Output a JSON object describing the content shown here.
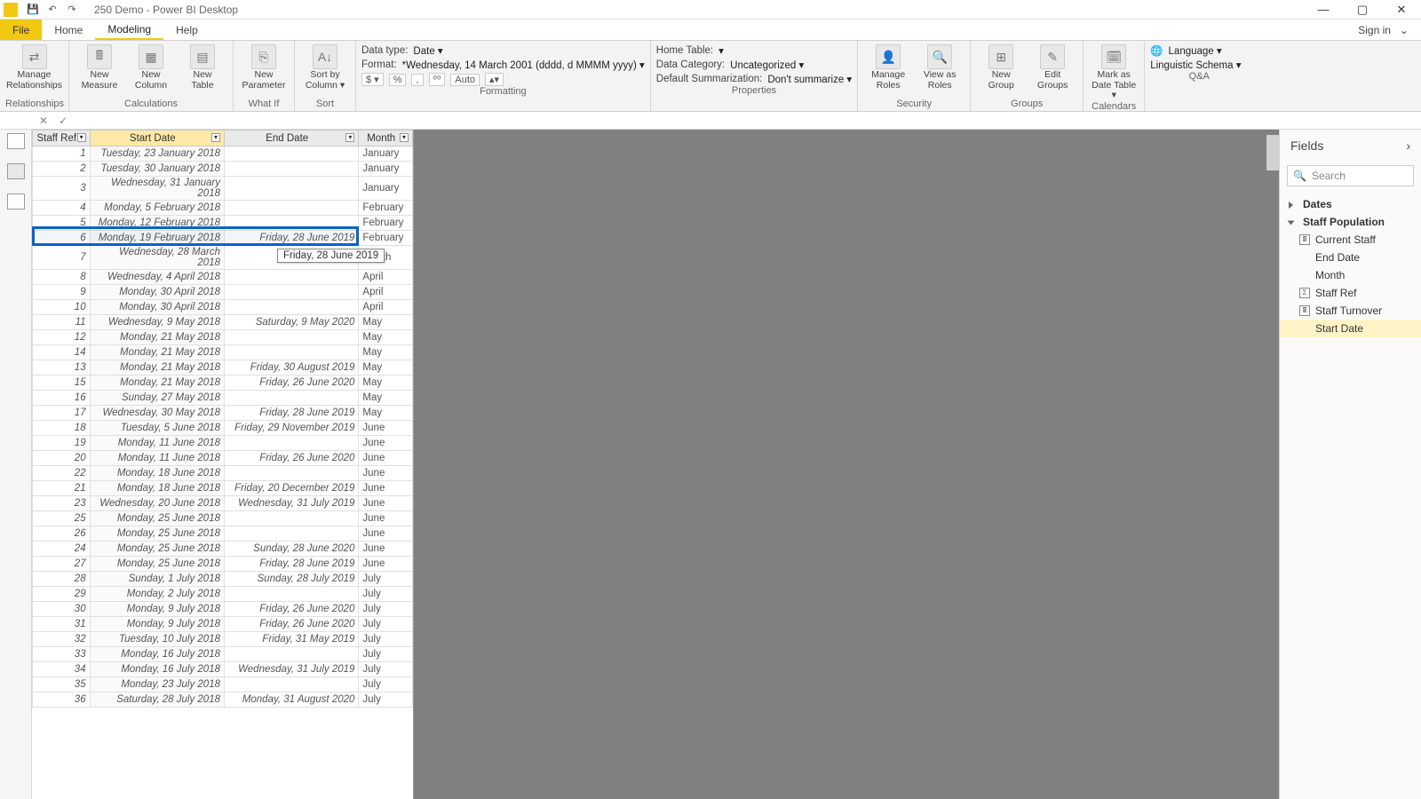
{
  "app": {
    "title": "250 Demo - Power BI Desktop"
  },
  "qat": {
    "save": "💾",
    "undo": "↶",
    "redo": "↷"
  },
  "winctl": {
    "min": "—",
    "max": "▢",
    "close": "✕"
  },
  "menu": {
    "file": "File",
    "home": "Home",
    "modeling": "Modeling",
    "help": "Help",
    "signin": "Sign in"
  },
  "ribbon": {
    "relationships": {
      "manage": "Manage\nRelationships",
      "group": "Relationships"
    },
    "calc": {
      "measure": "New\nMeasure",
      "column": "New\nColumn",
      "table": "New\nTable",
      "group": "Calculations"
    },
    "whatif": {
      "param": "New\nParameter",
      "group": "What If"
    },
    "sort": {
      "sortby": "Sort by\nColumn ▾",
      "group": "Sort"
    },
    "fmt": {
      "datatype_l": "Data type:",
      "datatype_v": "Date ▾",
      "format_l": "Format:",
      "format_v": "*Wednesday, 14 March 2001 (dddd, d MMMM yyyy) ▾",
      "cur": "$ ▾",
      "pct": "%",
      "comma": ",",
      "dec": "⁰⁰",
      "auto": "Auto",
      "spin": "▴▾",
      "group": "Formatting"
    },
    "props": {
      "hometable_l": "Home Table:",
      "hometable_v": "▾",
      "datacat_l": "Data Category:",
      "datacat_v": "Uncategorized ▾",
      "summ_l": "Default Summarization:",
      "summ_v": "Don't summarize ▾",
      "group": "Properties"
    },
    "sec": {
      "manage": "Manage\nRoles",
      "viewas": "View as\nRoles",
      "group": "Security"
    },
    "grp": {
      "new": "New\nGroup",
      "edit": "Edit\nGroups",
      "group": "Groups"
    },
    "cal": {
      "mark": "Mark as\nDate Table ▾",
      "group": "Calendars"
    },
    "qa": {
      "lang": "Language ▾",
      "ling": "Linguistic Schema ▾",
      "group": "Q&A"
    }
  },
  "fxbar": {
    "cancel": "✕",
    "commit": "✓"
  },
  "table": {
    "headers": {
      "staff": "Staff Ref",
      "start": "Start Date",
      "end": "End Date",
      "month": "Month"
    },
    "rows": [
      {
        "r": "1",
        "s": "Tuesday, 23 January 2018",
        "e": "",
        "m": "January"
      },
      {
        "r": "2",
        "s": "Tuesday, 30 January 2018",
        "e": "",
        "m": "January"
      },
      {
        "r": "3",
        "s": "Wednesday, 31 January 2018",
        "e": "",
        "m": "January"
      },
      {
        "r": "4",
        "s": "Monday, 5 February 2018",
        "e": "",
        "m": "February"
      },
      {
        "r": "5",
        "s": "Monday, 12 February 2018",
        "e": "",
        "m": "February"
      },
      {
        "r": "6",
        "s": "Monday, 19 February 2018",
        "e": "Friday, 28 June 2019",
        "m": "February"
      },
      {
        "r": "7",
        "s": "Wednesday, 28 March 2018",
        "e": "",
        "m": "March"
      },
      {
        "r": "8",
        "s": "Wednesday, 4 April 2018",
        "e": "",
        "m": "April"
      },
      {
        "r": "9",
        "s": "Monday, 30 April 2018",
        "e": "",
        "m": "April"
      },
      {
        "r": "10",
        "s": "Monday, 30 April 2018",
        "e": "",
        "m": "April"
      },
      {
        "r": "11",
        "s": "Wednesday, 9 May 2018",
        "e": "Saturday, 9 May 2020",
        "m": "May"
      },
      {
        "r": "12",
        "s": "Monday, 21 May 2018",
        "e": "",
        "m": "May"
      },
      {
        "r": "14",
        "s": "Monday, 21 May 2018",
        "e": "",
        "m": "May"
      },
      {
        "r": "13",
        "s": "Monday, 21 May 2018",
        "e": "Friday, 30 August 2019",
        "m": "May"
      },
      {
        "r": "15",
        "s": "Monday, 21 May 2018",
        "e": "Friday, 26 June 2020",
        "m": "May"
      },
      {
        "r": "16",
        "s": "Sunday, 27 May 2018",
        "e": "",
        "m": "May"
      },
      {
        "r": "17",
        "s": "Wednesday, 30 May 2018",
        "e": "Friday, 28 June 2019",
        "m": "May"
      },
      {
        "r": "18",
        "s": "Tuesday, 5 June 2018",
        "e": "Friday, 29 November 2019",
        "m": "June"
      },
      {
        "r": "19",
        "s": "Monday, 11 June 2018",
        "e": "",
        "m": "June"
      },
      {
        "r": "20",
        "s": "Monday, 11 June 2018",
        "e": "Friday, 26 June 2020",
        "m": "June"
      },
      {
        "r": "22",
        "s": "Monday, 18 June 2018",
        "e": "",
        "m": "June"
      },
      {
        "r": "21",
        "s": "Monday, 18 June 2018",
        "e": "Friday, 20 December 2019",
        "m": "June"
      },
      {
        "r": "23",
        "s": "Wednesday, 20 June 2018",
        "e": "Wednesday, 31 July 2019",
        "m": "June"
      },
      {
        "r": "25",
        "s": "Monday, 25 June 2018",
        "e": "",
        "m": "June"
      },
      {
        "r": "26",
        "s": "Monday, 25 June 2018",
        "e": "",
        "m": "June"
      },
      {
        "r": "24",
        "s": "Monday, 25 June 2018",
        "e": "Sunday, 28 June 2020",
        "m": "June"
      },
      {
        "r": "27",
        "s": "Monday, 25 June 2018",
        "e": "Friday, 28 June 2019",
        "m": "June"
      },
      {
        "r": "28",
        "s": "Sunday, 1 July 2018",
        "e": "Sunday, 28 July 2019",
        "m": "July"
      },
      {
        "r": "29",
        "s": "Monday, 2 July 2018",
        "e": "",
        "m": "July"
      },
      {
        "r": "30",
        "s": "Monday, 9 July 2018",
        "e": "Friday, 26 June 2020",
        "m": "July"
      },
      {
        "r": "31",
        "s": "Monday, 9 July 2018",
        "e": "Friday, 26 June 2020",
        "m": "July"
      },
      {
        "r": "32",
        "s": "Tuesday, 10 July 2018",
        "e": "Friday, 31 May 2019",
        "m": "July"
      },
      {
        "r": "33",
        "s": "Monday, 16 July 2018",
        "e": "",
        "m": "July"
      },
      {
        "r": "34",
        "s": "Monday, 16 July 2018",
        "e": "Wednesday, 31 July 2019",
        "m": "July"
      },
      {
        "r": "35",
        "s": "Monday, 23 July 2018",
        "e": "",
        "m": "July"
      },
      {
        "r": "36",
        "s": "Saturday, 28 July 2018",
        "e": "Monday, 31 August 2020",
        "m": "July"
      }
    ]
  },
  "tooltip": {
    "value": "Friday, 28 June 2019"
  },
  "fields": {
    "title": "Fields",
    "search_ph": "Search",
    "tables": {
      "dates": "Dates",
      "staffpop": "Staff Population",
      "items": {
        "current": "Current Staff",
        "enddate": "End Date",
        "month": "Month",
        "staffref": "Staff Ref",
        "turnover": "Staff Turnover",
        "startdate": "Start Date"
      }
    }
  }
}
